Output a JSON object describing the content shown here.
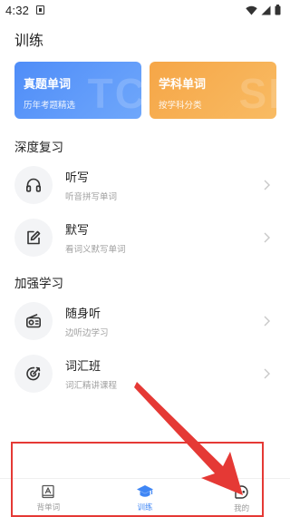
{
  "status_bar": {
    "time": "4:32"
  },
  "header": {
    "title": "训练"
  },
  "cards": [
    {
      "title": "真题单词",
      "subtitle": "历年考题精选",
      "watermark": "TC",
      "color": "#4f8df8"
    },
    {
      "title": "学科单词",
      "subtitle": "按学科分类",
      "watermark": "SI",
      "color": "#f6a647"
    }
  ],
  "sections": {
    "deep_review": {
      "title": "深度复习",
      "items": [
        {
          "title": "听写",
          "subtitle": "听音拼写单词",
          "icon": "headphones-icon"
        },
        {
          "title": "默写",
          "subtitle": "看词义默写单词",
          "icon": "edit-note-icon"
        }
      ]
    },
    "strengthen": {
      "title": "加强学习",
      "items": [
        {
          "title": "随身听",
          "subtitle": "边听边学习",
          "icon": "radio-icon"
        },
        {
          "title": "词汇班",
          "subtitle": "词汇精讲课程",
          "icon": "target-icon"
        }
      ]
    }
  },
  "tab_bar": {
    "tabs": [
      {
        "label": "背单词",
        "icon": "book-icon",
        "active": false
      },
      {
        "label": "训练",
        "icon": "graduation-cap-icon",
        "active": true
      },
      {
        "label": "我的",
        "icon": "profile-icon",
        "active": false
      }
    ],
    "active_color": "#3f86f5"
  },
  "annotation": {
    "color": "#e53935"
  }
}
